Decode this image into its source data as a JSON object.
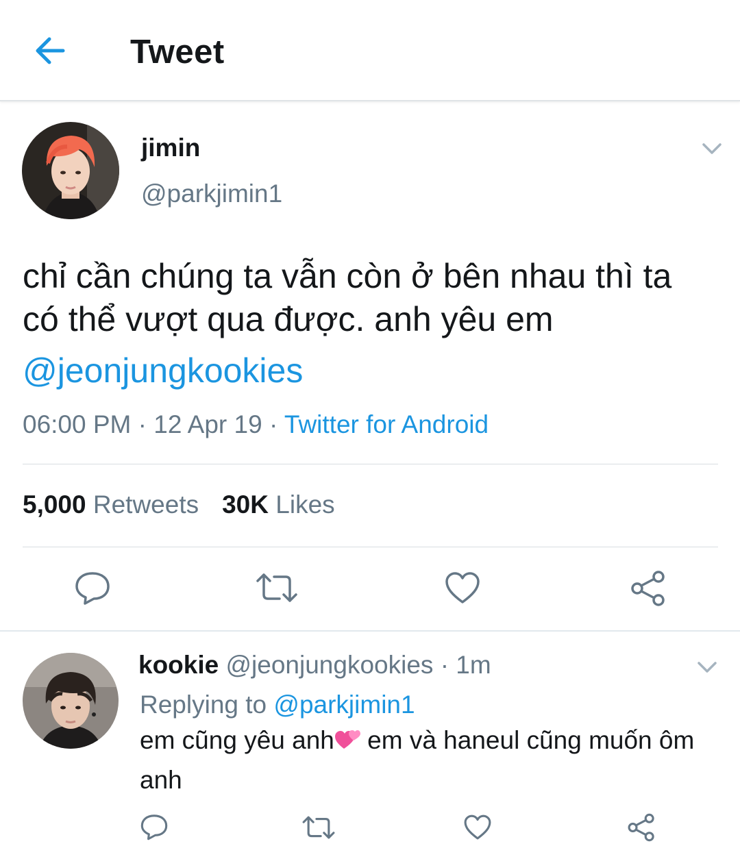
{
  "header": {
    "title": "Tweet",
    "back_icon": "arrow-left-icon",
    "accent": "#1b95e0"
  },
  "tweet": {
    "author_name": "jimin",
    "author_handle": "@parkjimin1",
    "text": "chỉ cần chúng ta vẫn còn ở bên nhau thì ta có thể vượt qua được. anh yêu em",
    "mention": "@jeonjungkookies",
    "time": "06:00 PM",
    "separator": " · ",
    "date": "12 Apr 19",
    "source": "Twitter for Android",
    "retweet_count": "5,000",
    "retweet_label": "Retweets",
    "like_count": "30K",
    "like_label": "Likes"
  },
  "reply": {
    "author_name": "kookie",
    "author_handle": "@jeonjungkookies",
    "time": " · 1m",
    "replying_label": "Replying to ",
    "replying_to": "@parkjimin1",
    "text_part1": "em cũng yêu anh",
    "emoji": "two-hearts-emoji",
    "text_part2": " em và haneul cũng muốn ôm anh"
  },
  "actions": {
    "icons": [
      "reply-icon",
      "retweet-icon",
      "like-icon",
      "share-icon"
    ]
  },
  "colors": {
    "text": "#14171a",
    "secondary": "#657786",
    "link": "#1b95e0",
    "border": "#e1e8ed"
  }
}
